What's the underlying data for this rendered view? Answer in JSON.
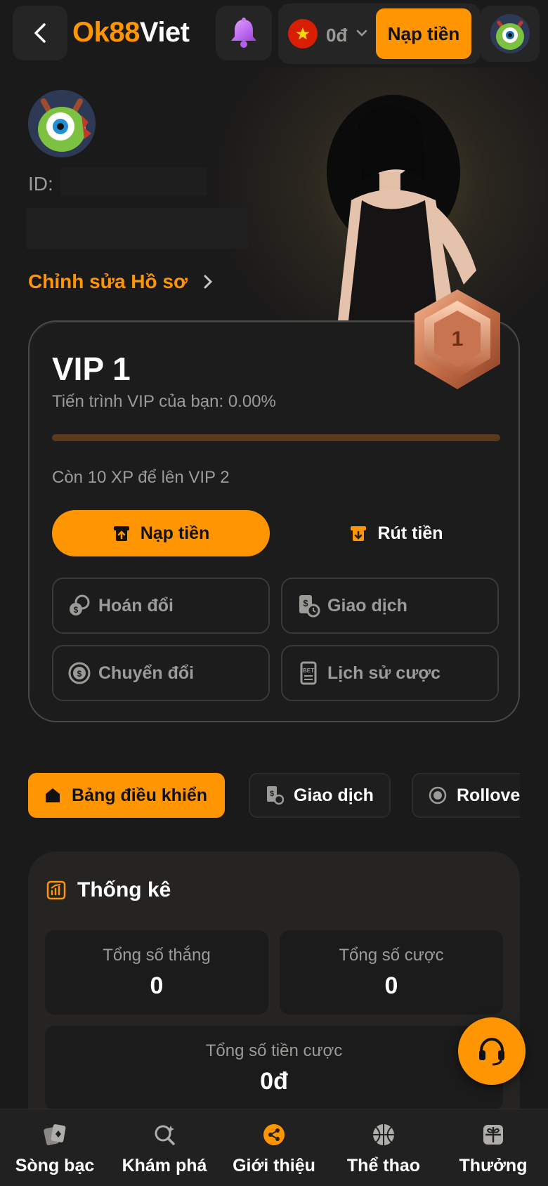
{
  "header": {
    "back_icon": "chevron-left-icon",
    "logo_part1": "Ok88",
    "logo_part2": "Viet",
    "bell_icon": "bell-icon",
    "balance": "0đ",
    "currency_flag": "vietnam-flag-icon",
    "deposit_label": "Nạp tiền",
    "avatar_icon": "user-avatar-icon"
  },
  "profile": {
    "id_label": "ID:",
    "edit_label": "Chỉnh sửa Hồ sơ"
  },
  "vip": {
    "level_title": "VIP 1",
    "badge_number": "1",
    "progress_text": "Tiến trình VIP của bạn: 0.00%",
    "progress_value": 0.0,
    "remaining_text": "Còn 10 XP để lên VIP 2",
    "deposit_label": "Nạp tiền",
    "withdraw_label": "Rút tiền",
    "actions": [
      {
        "label": "Hoán đổi",
        "icon": "coins-swap-icon"
      },
      {
        "label": "Giao dịch",
        "icon": "transaction-icon"
      },
      {
        "label": "Chuyển đổi",
        "icon": "exchange-coin-icon"
      },
      {
        "label": "Lịch sử cược",
        "icon": "bet-history-icon"
      }
    ]
  },
  "tabs": [
    {
      "label": "Bảng điều khiển",
      "icon": "home-icon",
      "active": true
    },
    {
      "label": "Giao dịch",
      "icon": "transaction-icon",
      "active": false
    },
    {
      "label": "Rollover",
      "icon": "rollover-icon",
      "active": false
    }
  ],
  "stats": {
    "title": "Thống kê",
    "total_wins_label": "Tổng số thắng",
    "total_wins_value": "0",
    "total_bets_label": "Tổng số cược",
    "total_bets_value": "0",
    "total_wagered_label": "Tổng số tiền cược",
    "total_wagered_value": "0đ"
  },
  "bottom_nav": [
    {
      "label": "Sòng bạc",
      "icon": "cards-icon"
    },
    {
      "label": "Khám phá",
      "icon": "explore-icon"
    },
    {
      "label": "Giới thiệu",
      "icon": "share-icon"
    },
    {
      "label": "Thể thao",
      "icon": "basketball-icon"
    },
    {
      "label": "Thưởng",
      "icon": "gift-icon"
    }
  ],
  "colors": {
    "accent": "#ff9500",
    "background": "#1b1a1a",
    "card": "#1d1c1c",
    "muted_text": "#9d9b98"
  }
}
